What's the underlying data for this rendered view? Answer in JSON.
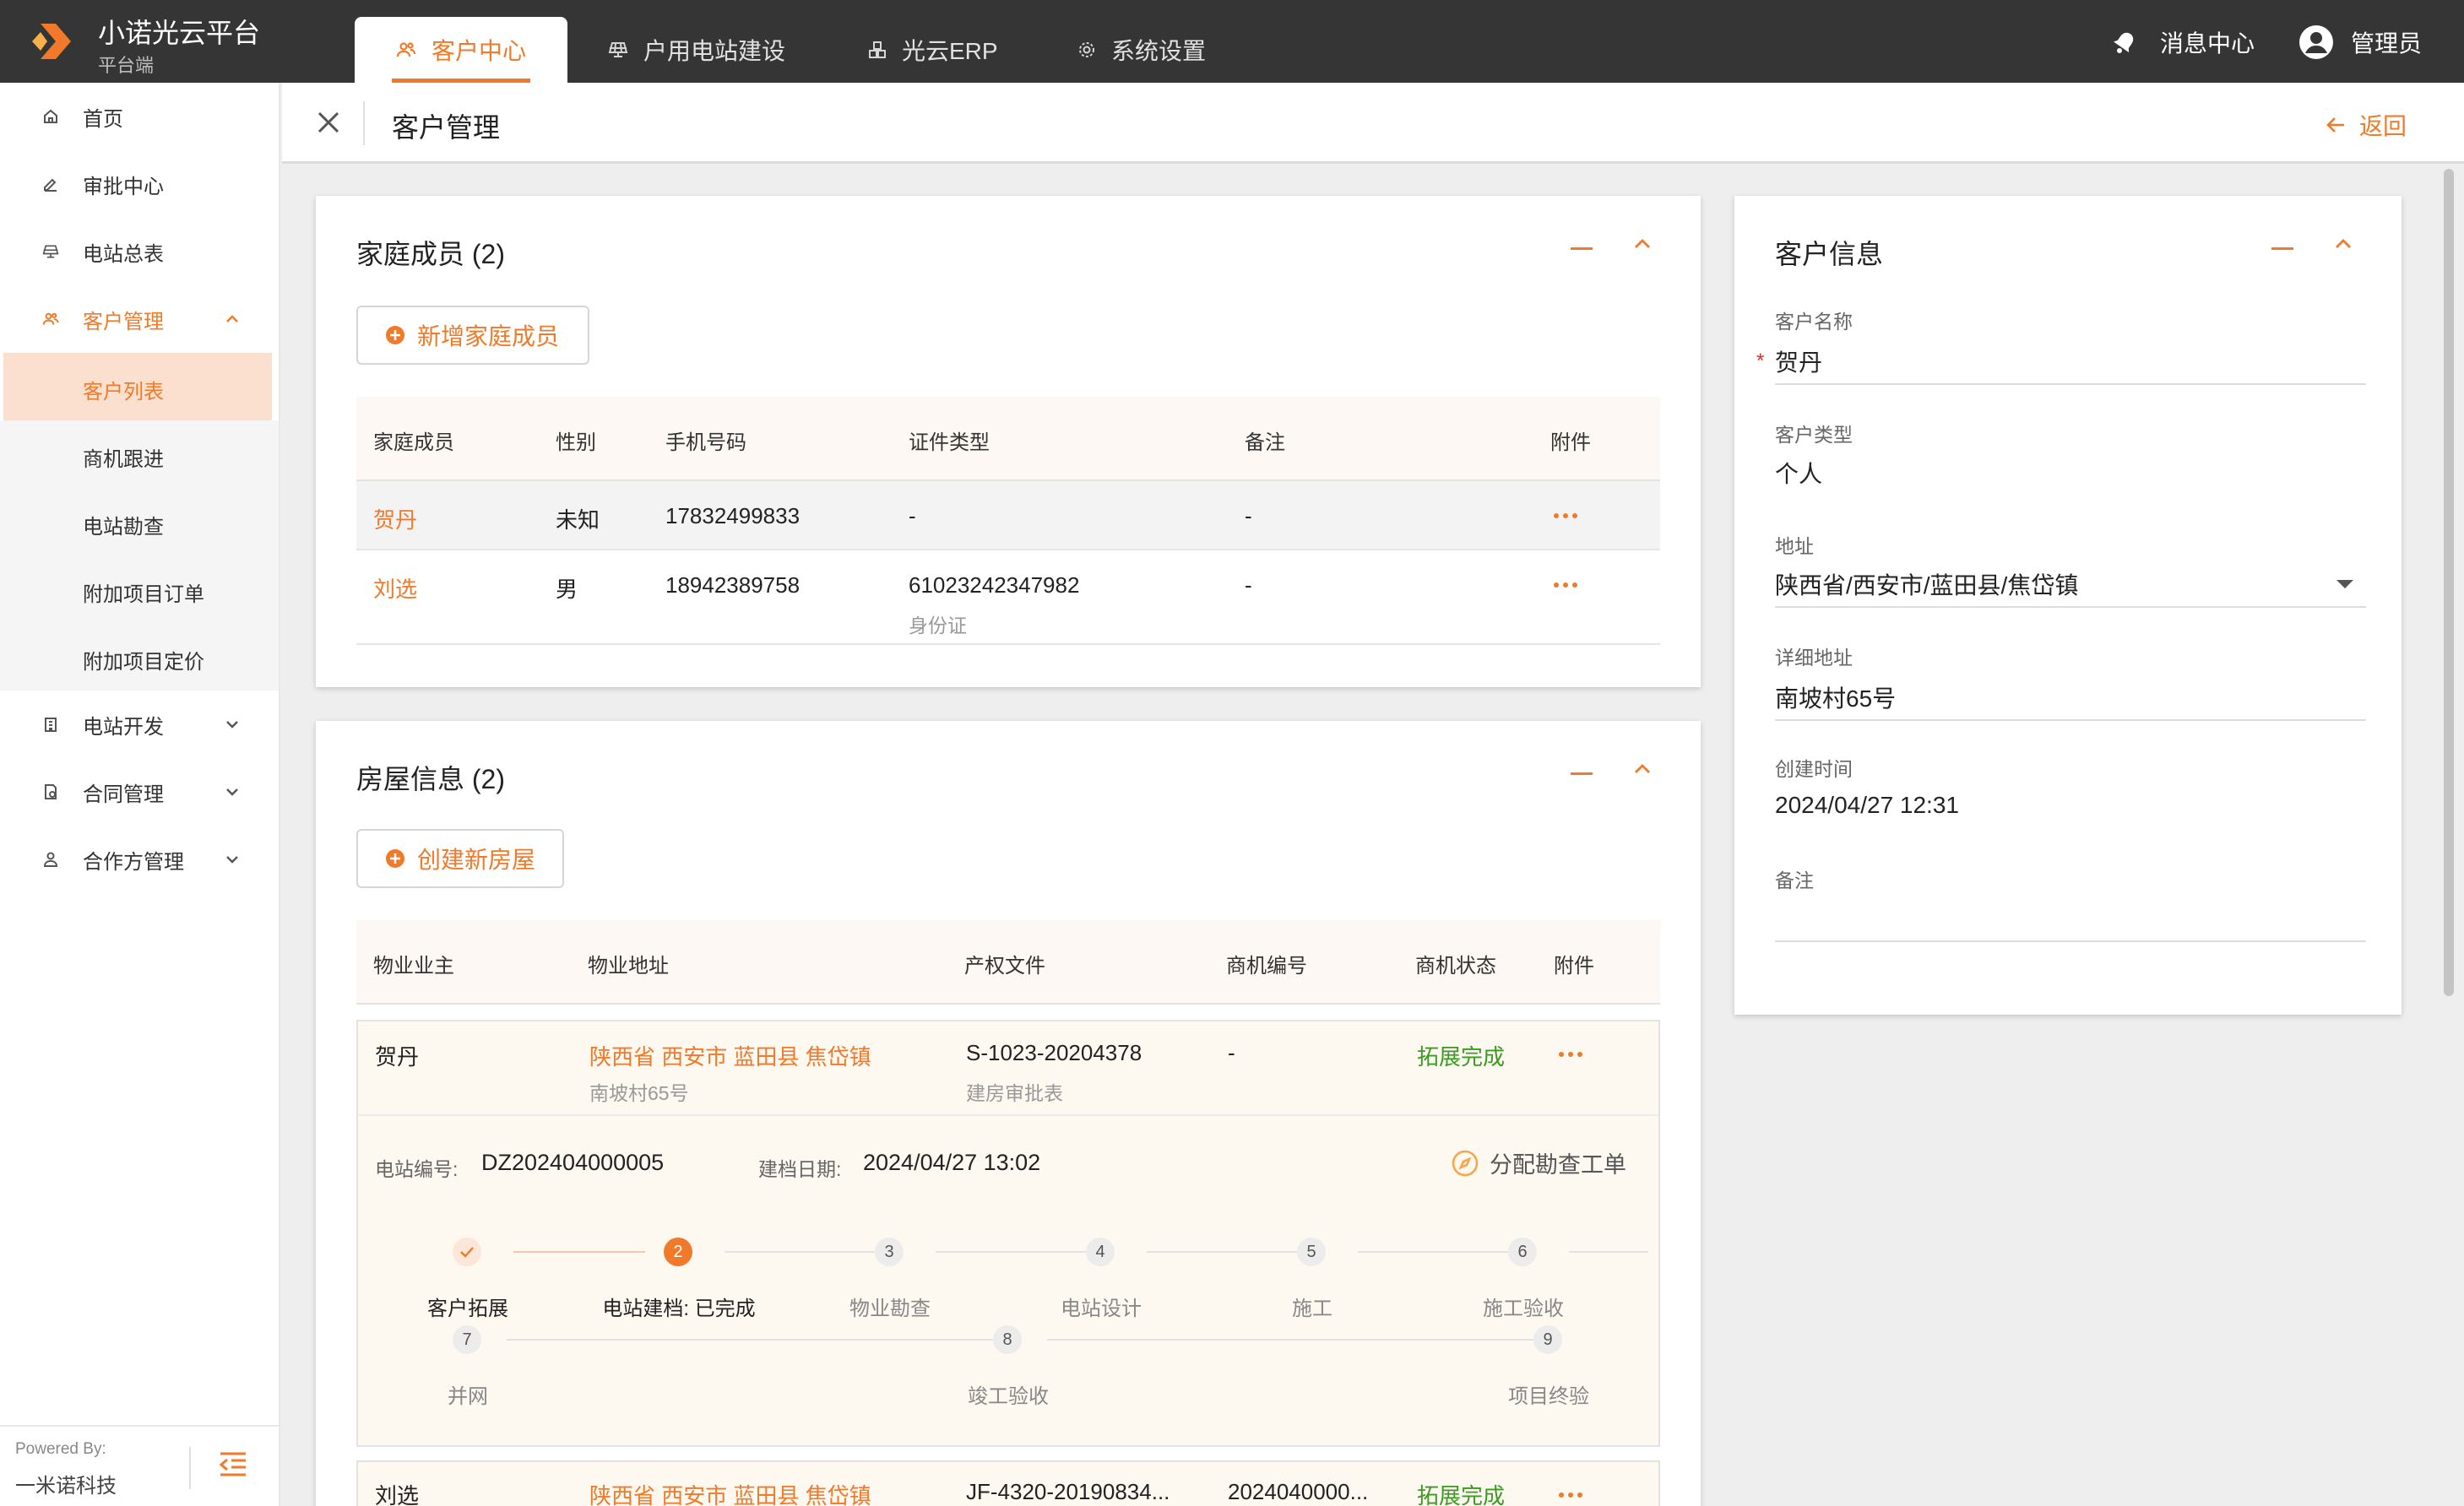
{
  "app": {
    "title": "小诺光云平台",
    "subtitle": "平台端",
    "tabs": [
      {
        "label": "客户中心",
        "icon": "users-icon",
        "active": true
      },
      {
        "label": "户用电站建设",
        "icon": "solar-panel-icon"
      },
      {
        "label": "光云ERP",
        "icon": "cubes-icon"
      },
      {
        "label": "系统设置",
        "icon": "gear-icon"
      }
    ],
    "messages_label": "消息中心",
    "user_label": "管理员"
  },
  "sidebar": {
    "items": [
      {
        "label": "首页",
        "icon": "home-icon"
      },
      {
        "label": "审批中心",
        "icon": "edit-icon"
      },
      {
        "label": "电站总表",
        "icon": "solar-panel-icon"
      },
      {
        "label": "客户管理",
        "icon": "users-icon",
        "expanded": true
      },
      {
        "label": "电站开发",
        "icon": "building-icon"
      },
      {
        "label": "合同管理",
        "icon": "contract-icon"
      },
      {
        "label": "合作方管理",
        "icon": "partner-icon"
      }
    ],
    "sub_items": [
      {
        "label": "客户列表",
        "active": true
      },
      {
        "label": "商机跟进"
      },
      {
        "label": "电站勘查"
      },
      {
        "label": "附加项目订单"
      },
      {
        "label": "附加项目定价"
      }
    ],
    "powered_by": "Powered By:",
    "company": "一米诺科技"
  },
  "page": {
    "title": "客户管理",
    "back_label": "返回"
  },
  "family": {
    "title": "家庭成员 (2)",
    "add_label": "新增家庭成员",
    "columns": [
      "家庭成员",
      "性别",
      "手机号码",
      "证件类型",
      "备注",
      "附件"
    ],
    "rows": [
      {
        "name": "贺丹",
        "gender": "未知",
        "phone": "17832499833",
        "id_number": "-",
        "id_type": "",
        "remark": "-"
      },
      {
        "name": "刘选",
        "gender": "男",
        "phone": "18942389758",
        "id_number": "61023242347982",
        "id_type": "身份证",
        "remark": "-"
      }
    ]
  },
  "house": {
    "title": "房屋信息 (2)",
    "create_label": "创建新房屋",
    "columns": [
      "物业业主",
      "物业地址",
      "产权文件",
      "商机编号",
      "商机状态",
      "附件"
    ],
    "rows": [
      {
        "owner": "贺丹",
        "address": "陕西省 西安市 蓝田县 焦岱镇",
        "address_detail": "南坡村65号",
        "property_doc": "S-1023-20204378",
        "doc_type": "建房审批表",
        "opportunity": "-",
        "status": "拓展完成"
      },
      {
        "owner": "刘选",
        "address": "陕西省 西安市 蓝田县 焦岱镇",
        "address_detail": "",
        "property_doc": "JF-4320-20190834...",
        "doc_type": "",
        "opportunity": "2024040000...",
        "status": "拓展完成"
      }
    ],
    "detail": {
      "station_label": "电站编号:",
      "station_value": "DZ202404000005",
      "date_label": "建档日期:",
      "date_value": "2024/04/27 13:02",
      "assign_label": "分配勘查工单"
    },
    "steps": [
      {
        "num": "1",
        "label": "客户拓展",
        "state": "done"
      },
      {
        "num": "2",
        "label": "电站建档: 已完成",
        "state": "active"
      },
      {
        "num": "3",
        "label": "物业勘查"
      },
      {
        "num": "4",
        "label": "电站设计"
      },
      {
        "num": "5",
        "label": "施工"
      },
      {
        "num": "6",
        "label": "施工验收"
      },
      {
        "num": "7",
        "label": "并网"
      },
      {
        "num": "8",
        "label": "竣工验收"
      },
      {
        "num": "9",
        "label": "项目终验"
      }
    ]
  },
  "customer": {
    "title": "客户信息",
    "name_label": "客户名称",
    "name_value": "贺丹",
    "required_mark": "*",
    "type_label": "客户类型",
    "type_value": "个人",
    "address_label": "地址",
    "address_value": "陕西省/西安市/蓝田县/焦岱镇",
    "detail_label": "详细地址",
    "detail_value": "南坡村65号",
    "created_label": "创建时间",
    "created_value": "2024/04/27 12:31",
    "remark_label": "备注",
    "remark_value": ""
  },
  "colors": {
    "accent": "#f07a29",
    "topbar": "#353535",
    "success": "#3a9a22"
  }
}
